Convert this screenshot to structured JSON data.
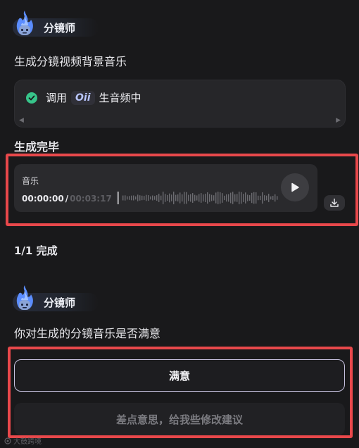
{
  "agent": {
    "name": "分镜师"
  },
  "step_title": "生成分镜视频背景音乐",
  "tool_call": {
    "prefix": "调用",
    "tool_name": "Oii",
    "suffix": "生音频中"
  },
  "done_title": "生成完毕",
  "audio": {
    "title": "音乐",
    "current_time": "00:00:00",
    "separator": "/",
    "duration": "00:03:17",
    "progress": 0
  },
  "progress_text": "1/1 完成",
  "agent2": {
    "name": "分镜师"
  },
  "question": "你对生成的分镜音乐是否满意",
  "buttons": {
    "satisfied": "满意",
    "suggest": "差点意思，给我些修改建议"
  },
  "watermark": "大鼓跨境",
  "colors": {
    "highlight": "#e8484b",
    "check": "#37c48a",
    "background": "#19191b"
  }
}
